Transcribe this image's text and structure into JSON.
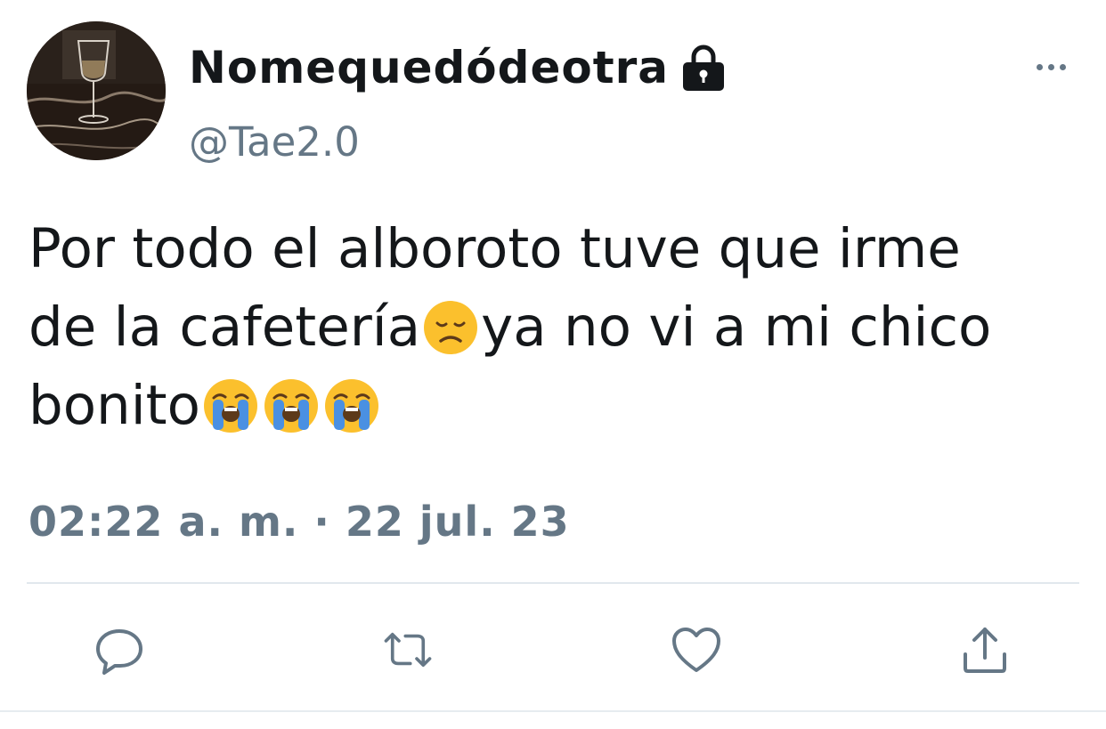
{
  "tweet": {
    "display_name": "Nomequedódeotra",
    "handle": "@Tae2.0",
    "protected_icon": "lock-icon",
    "avatar_icon": "wine-glass-avatar",
    "more_icon": "more-options-icon",
    "text_line_1": "Por todo el alboroto tuve que irme",
    "text_line_2_a": "de la cafetería",
    "text_line_2_b": "ya no vi a mi chico",
    "text_line_3": "bonito",
    "emojis": [
      "disappointed-face",
      "loudly-crying-face",
      "loudly-crying-face",
      "loudly-crying-face"
    ],
    "timestamp": "02:22 a. m. · 22 jul. 23"
  },
  "actions": {
    "reply_icon": "reply-icon",
    "retweet_icon": "retweet-icon",
    "like_icon": "heart-icon",
    "share_icon": "share-icon"
  },
  "colors": {
    "text": "#14171a",
    "secondary": "#657786",
    "divider": "#e1e8ed",
    "emoji_yellow": "#fbc02d",
    "tears_blue": "#4a90e2"
  }
}
